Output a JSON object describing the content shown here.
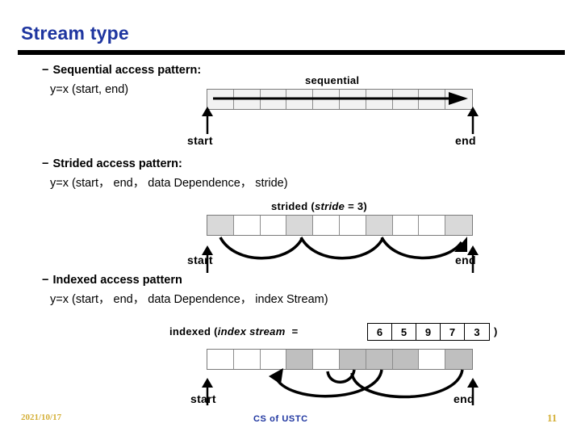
{
  "slide": {
    "title": "Stream type",
    "accent_color": "#1f36a0",
    "gold_color": "#d4af37"
  },
  "bullets": [
    {
      "dash": "−",
      "head": "Sequential access pattern:",
      "sub": "y=x (start, end)"
    },
    {
      "dash": "−",
      "head": "Strided access pattern:",
      "sub": "y=x (start， end， data Dependence， stride)"
    },
    {
      "dash": "−",
      "head": "Indexed access pattern",
      "sub": "y=x (start， end， data Dependence， index Stream)"
    }
  ],
  "diagrams": {
    "sequential": {
      "caption": "sequential",
      "cells": 10,
      "shaded_cells": [],
      "start_label": "start",
      "end_label": "end"
    },
    "strided": {
      "caption_prefix": "strided (",
      "caption_italic": "stride",
      "caption_suffix": " = 3)",
      "stride": 3,
      "cells": 10,
      "shaded_cells": [
        1,
        4,
        7,
        10
      ],
      "start_label": "start",
      "end_label": "end"
    },
    "indexed": {
      "caption_prefix": "indexed (",
      "caption_italic": "index stream",
      "caption_equals": "=",
      "caption_suffix": ")",
      "index_stream": [
        6,
        5,
        9,
        7,
        3
      ],
      "cells": 10,
      "shaded_cells": [
        4,
        6,
        7,
        8,
        10
      ],
      "start_label": "start",
      "end_label": "end"
    }
  },
  "footer": {
    "date": "2021/10/17",
    "center": "CS of USTC",
    "page": "11"
  }
}
